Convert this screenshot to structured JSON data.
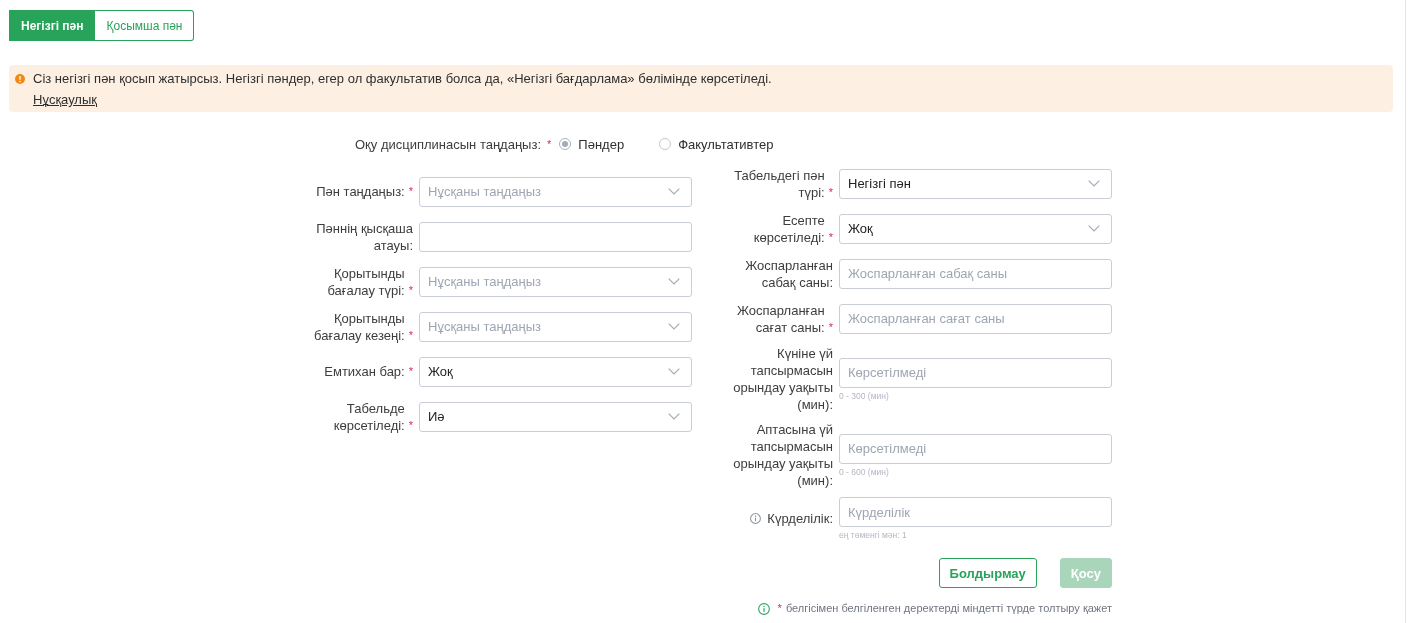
{
  "tabs": [
    {
      "label": "Негізгі пән",
      "selected": true
    },
    {
      "label": "Қосымша пән",
      "selected": false
    }
  ],
  "alert": {
    "text": "Сіз негізгі пән қосып жатырсыз. Негізгі пәндер, егер ол факультатив болса да, «Негізгі бағдарлама» бөлімінде көрсетіледі.",
    "link": "Нұсқаулық"
  },
  "discipline": {
    "label": "Оқу дисциплинасын таңдаңыз:",
    "required_mark": "*",
    "options": [
      {
        "label": "Пәндер",
        "selected": true
      },
      {
        "label": "Факультативтер",
        "selected": false
      }
    ]
  },
  "left_fields": [
    {
      "label": "Пән таңдаңыз:",
      "required_mark": "*",
      "kind": "select",
      "placeholder": "Нұсқаны таңдаңыз"
    },
    {
      "label": "Пәннің қысқаша атауы:",
      "kind": "input"
    },
    {
      "label": "Қорытынды бағалау түрі:",
      "required_mark": "*",
      "kind": "select",
      "placeholder": "Нұсқаны таңдаңыз"
    },
    {
      "label": "Қорытынды бағалау кезеңі:",
      "required_mark": "*",
      "kind": "select",
      "placeholder": "Нұсқаны таңдаңыз"
    },
    {
      "label": "Емтихан бар:",
      "required_mark": "*",
      "kind": "select",
      "value": "Жоқ"
    },
    {
      "label": "Табельде көрсетіледі:",
      "required_mark": "*",
      "kind": "select",
      "value": "Иә"
    }
  ],
  "right_fields": [
    {
      "label": "Табельдегі пән түрі:",
      "required_mark": "*",
      "kind": "select",
      "value": "Негізгі пән"
    },
    {
      "label": "Есепте көрсетіледі:",
      "required_mark": "*",
      "kind": "select",
      "value": "Жоқ"
    },
    {
      "label": "Жоспарланған сабақ саны:",
      "kind": "input",
      "placeholder": "Жоспарланған сабақ саны"
    },
    {
      "label": "Жоспарланған сағат саны:",
      "required_mark": "*",
      "kind": "input",
      "placeholder": "Жоспарланған сағат саны"
    },
    {
      "label": "Күніне үй тапсырмасын орындау уақыты (мин):",
      "kind": "input",
      "placeholder": "Көрсетілмеді",
      "hint": "0 - 300 (мин)"
    },
    {
      "label": "Аптасына үй тапсырмасын орындау уақыты (мин):",
      "kind": "input",
      "placeholder": "Көрсетілмеді",
      "hint": "0 - 600 (мин)"
    },
    {
      "label": "Күрделілік:",
      "info_icon": true,
      "kind": "input",
      "placeholder": "Күрделілік",
      "hint": "ең төменгі мән: 1"
    }
  ],
  "buttons": [
    {
      "label": "Болдырмау",
      "kind": "cancel",
      "disabled": false
    },
    {
      "label": "Қосу",
      "kind": "submit",
      "disabled": true
    }
  ],
  "footnote": {
    "mark": "*",
    "text": "белгісімен белгіленген деректерді міндетті түрде толтыру қажет"
  }
}
